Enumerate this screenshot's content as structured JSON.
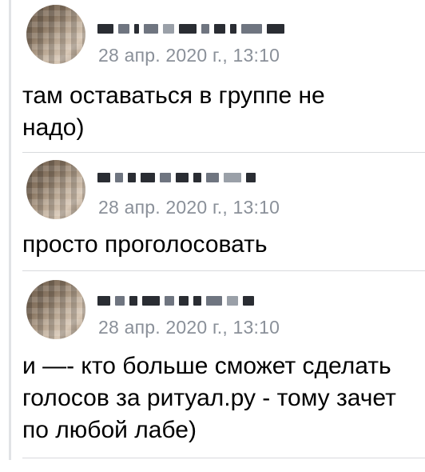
{
  "messages": [
    {
      "date": "28 апр. 2020 г., 13:10",
      "text": "там оставаться в группе не надо)"
    },
    {
      "date": "28 апр. 2020 г., 13:10",
      "text": "просто проголосовать"
    },
    {
      "date": "28 апр. 2020 г., 13:10",
      "text": "и —- кто больше сможет сделать голосов за ритуал.ру - тому зачет по любой лабе)"
    }
  ],
  "colors": {
    "meta": "#8a9099",
    "thread_line": "#e1e3e6",
    "text": "#000000"
  },
  "icons": {
    "avatar": "blurred-avatar-photo"
  }
}
